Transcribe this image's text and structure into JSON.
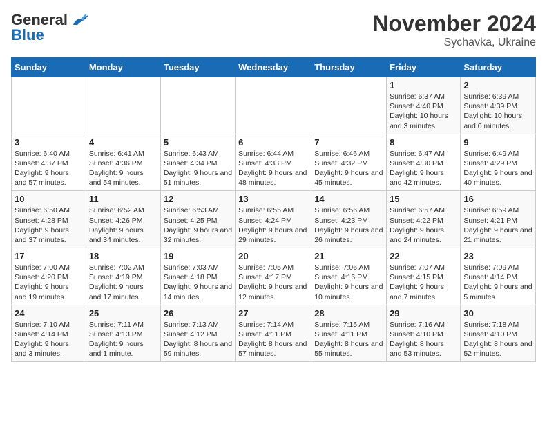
{
  "logo": {
    "general": "General",
    "blue": "Blue"
  },
  "title": "November 2024",
  "subtitle": "Sychavka, Ukraine",
  "days_of_week": [
    "Sunday",
    "Monday",
    "Tuesday",
    "Wednesday",
    "Thursday",
    "Friday",
    "Saturday"
  ],
  "weeks": [
    [
      {
        "day": "",
        "info": ""
      },
      {
        "day": "",
        "info": ""
      },
      {
        "day": "",
        "info": ""
      },
      {
        "day": "",
        "info": ""
      },
      {
        "day": "",
        "info": ""
      },
      {
        "day": "1",
        "info": "Sunrise: 6:37 AM\nSunset: 4:40 PM\nDaylight: 10 hours and 3 minutes."
      },
      {
        "day": "2",
        "info": "Sunrise: 6:39 AM\nSunset: 4:39 PM\nDaylight: 10 hours and 0 minutes."
      }
    ],
    [
      {
        "day": "3",
        "info": "Sunrise: 6:40 AM\nSunset: 4:37 PM\nDaylight: 9 hours and 57 minutes."
      },
      {
        "day": "4",
        "info": "Sunrise: 6:41 AM\nSunset: 4:36 PM\nDaylight: 9 hours and 54 minutes."
      },
      {
        "day": "5",
        "info": "Sunrise: 6:43 AM\nSunset: 4:34 PM\nDaylight: 9 hours and 51 minutes."
      },
      {
        "day": "6",
        "info": "Sunrise: 6:44 AM\nSunset: 4:33 PM\nDaylight: 9 hours and 48 minutes."
      },
      {
        "day": "7",
        "info": "Sunrise: 6:46 AM\nSunset: 4:32 PM\nDaylight: 9 hours and 45 minutes."
      },
      {
        "day": "8",
        "info": "Sunrise: 6:47 AM\nSunset: 4:30 PM\nDaylight: 9 hours and 42 minutes."
      },
      {
        "day": "9",
        "info": "Sunrise: 6:49 AM\nSunset: 4:29 PM\nDaylight: 9 hours and 40 minutes."
      }
    ],
    [
      {
        "day": "10",
        "info": "Sunrise: 6:50 AM\nSunset: 4:28 PM\nDaylight: 9 hours and 37 minutes."
      },
      {
        "day": "11",
        "info": "Sunrise: 6:52 AM\nSunset: 4:26 PM\nDaylight: 9 hours and 34 minutes."
      },
      {
        "day": "12",
        "info": "Sunrise: 6:53 AM\nSunset: 4:25 PM\nDaylight: 9 hours and 32 minutes."
      },
      {
        "day": "13",
        "info": "Sunrise: 6:55 AM\nSunset: 4:24 PM\nDaylight: 9 hours and 29 minutes."
      },
      {
        "day": "14",
        "info": "Sunrise: 6:56 AM\nSunset: 4:23 PM\nDaylight: 9 hours and 26 minutes."
      },
      {
        "day": "15",
        "info": "Sunrise: 6:57 AM\nSunset: 4:22 PM\nDaylight: 9 hours and 24 minutes."
      },
      {
        "day": "16",
        "info": "Sunrise: 6:59 AM\nSunset: 4:21 PM\nDaylight: 9 hours and 21 minutes."
      }
    ],
    [
      {
        "day": "17",
        "info": "Sunrise: 7:00 AM\nSunset: 4:20 PM\nDaylight: 9 hours and 19 minutes."
      },
      {
        "day": "18",
        "info": "Sunrise: 7:02 AM\nSunset: 4:19 PM\nDaylight: 9 hours and 17 minutes."
      },
      {
        "day": "19",
        "info": "Sunrise: 7:03 AM\nSunset: 4:18 PM\nDaylight: 9 hours and 14 minutes."
      },
      {
        "day": "20",
        "info": "Sunrise: 7:05 AM\nSunset: 4:17 PM\nDaylight: 9 hours and 12 minutes."
      },
      {
        "day": "21",
        "info": "Sunrise: 7:06 AM\nSunset: 4:16 PM\nDaylight: 9 hours and 10 minutes."
      },
      {
        "day": "22",
        "info": "Sunrise: 7:07 AM\nSunset: 4:15 PM\nDaylight: 9 hours and 7 minutes."
      },
      {
        "day": "23",
        "info": "Sunrise: 7:09 AM\nSunset: 4:14 PM\nDaylight: 9 hours and 5 minutes."
      }
    ],
    [
      {
        "day": "24",
        "info": "Sunrise: 7:10 AM\nSunset: 4:14 PM\nDaylight: 9 hours and 3 minutes."
      },
      {
        "day": "25",
        "info": "Sunrise: 7:11 AM\nSunset: 4:13 PM\nDaylight: 9 hours and 1 minute."
      },
      {
        "day": "26",
        "info": "Sunrise: 7:13 AM\nSunset: 4:12 PM\nDaylight: 8 hours and 59 minutes."
      },
      {
        "day": "27",
        "info": "Sunrise: 7:14 AM\nSunset: 4:11 PM\nDaylight: 8 hours and 57 minutes."
      },
      {
        "day": "28",
        "info": "Sunrise: 7:15 AM\nSunset: 4:11 PM\nDaylight: 8 hours and 55 minutes."
      },
      {
        "day": "29",
        "info": "Sunrise: 7:16 AM\nSunset: 4:10 PM\nDaylight: 8 hours and 53 minutes."
      },
      {
        "day": "30",
        "info": "Sunrise: 7:18 AM\nSunset: 4:10 PM\nDaylight: 8 hours and 52 minutes."
      }
    ]
  ]
}
